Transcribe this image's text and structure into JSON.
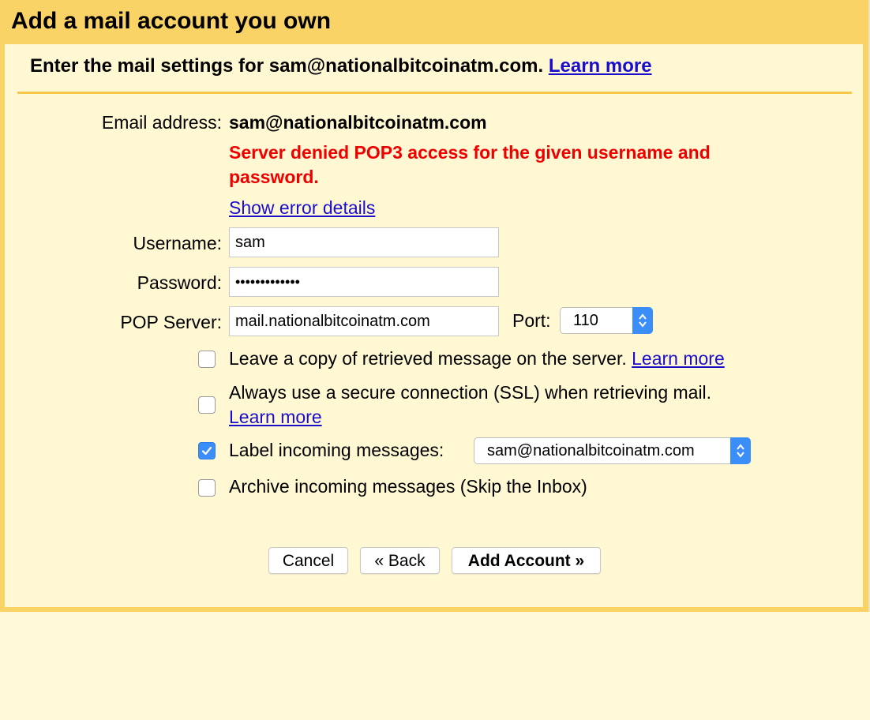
{
  "dialog": {
    "title": "Add a mail account you own",
    "subtitle": "Enter the mail settings for sam@nationalbitcoinatm.com.",
    "subtitle_link": "Learn more"
  },
  "form": {
    "email_label": "Email address:",
    "email_value": "sam@nationalbitcoinatm.com",
    "error_message": "Server denied POP3 access for the given username and password.",
    "error_details_link": "Show error details",
    "username_label": "Username:",
    "username_value": "sam",
    "password_label": "Password:",
    "password_value": "•••••••••••••",
    "pop_server_label": "POP Server:",
    "pop_server_value": "mail.nationalbitcoinatm.com",
    "port_label": "Port:",
    "port_value": "110"
  },
  "options": {
    "leave_copy": {
      "label": "Leave a copy of retrieved message on the server.",
      "link": "Learn more",
      "checked": false
    },
    "ssl": {
      "label": "Always use a secure connection (SSL) when retrieving mail.",
      "link": "Learn more",
      "checked": false
    },
    "label_incoming": {
      "label": "Label incoming messages:",
      "checked": true,
      "select_value": "sam@nationalbitcoinatm.com"
    },
    "archive": {
      "label": "Archive incoming messages (Skip the Inbox)",
      "checked": false
    }
  },
  "buttons": {
    "cancel": "Cancel",
    "back": "« Back",
    "add_account": "Add Account »"
  },
  "colors": {
    "header_bg": "#fad366",
    "panel_bg": "#fff8d3",
    "error": "#ee0000",
    "link": "#1a0dcc",
    "accent": "#3b8df7"
  }
}
